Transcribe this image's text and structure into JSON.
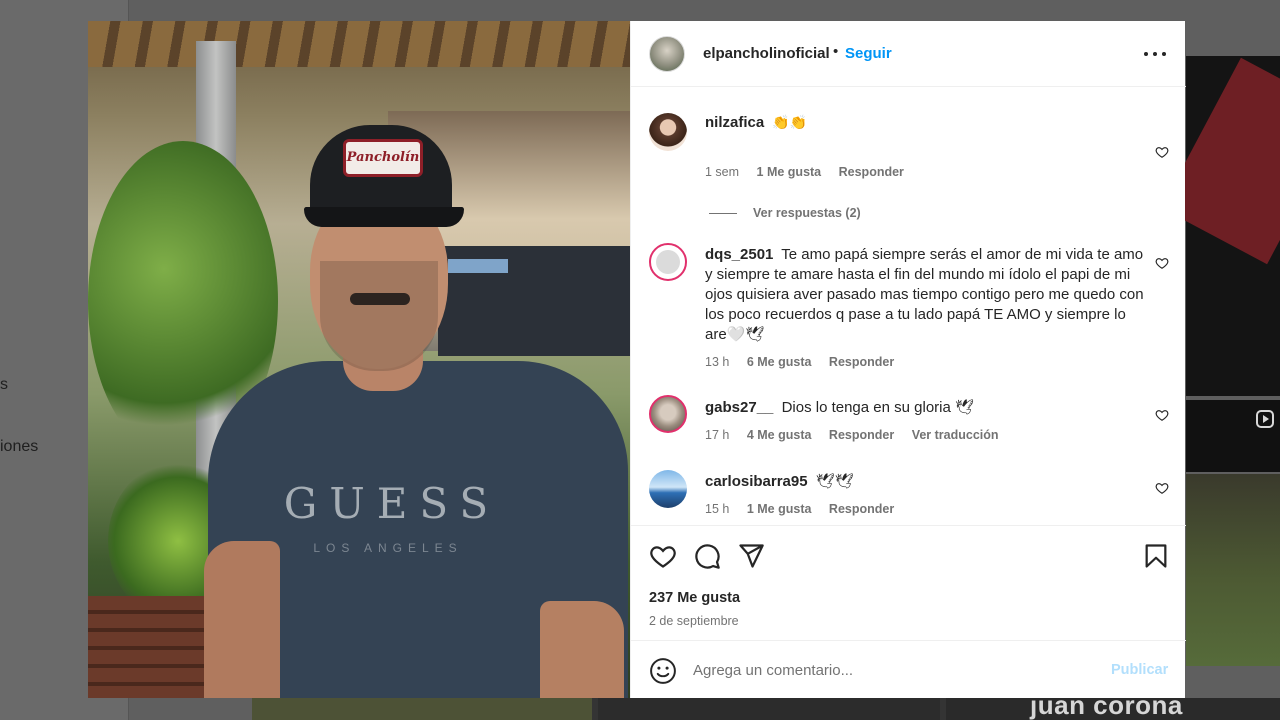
{
  "background": {
    "left_text": "iones",
    "left_text_2": "s",
    "thumb_caption": "juan corona"
  },
  "photo": {
    "cap_patch": "Pancholín",
    "shirt_brand": "GUESS",
    "shirt_sub": "LOS ANGELES"
  },
  "header": {
    "username": "elpancholinoficial",
    "separator": "•",
    "follow_label": "Seguir",
    "more_icon": "more-horizontal-icon"
  },
  "comments": [
    {
      "username": "nilzafica",
      "text": "👏👏",
      "time": "1 sem",
      "likes": "1 Me gusta",
      "reply": "Responder",
      "view_replies": "Ver respuestas (2)"
    },
    {
      "username": "dqs_2501",
      "text": "Te amo papá siempre serás el amor de mi vida te amo y siempre te amare hasta el fin del mundo mi ídolo el papi de mi ojos quisiera aver pasado mas tiempo contigo pero me quedo con los poco recuerdos q pase a tu lado papá TE AMO y siempre lo are🤍🕊",
      "time": "13 h",
      "likes": "6 Me gusta",
      "reply": "Responder"
    },
    {
      "username": "gabs27__",
      "text": "Dios lo tenga en su gloria 🕊",
      "time": "17 h",
      "likes": "4 Me gusta",
      "reply": "Responder",
      "translate": "Ver traducción"
    },
    {
      "username": "carlosibarra95",
      "text": "🕊🕊",
      "time": "15 h",
      "likes": "1 Me gusta",
      "reply": "Responder"
    }
  ],
  "post": {
    "likes": "237 Me gusta",
    "date": "2 de septiembre"
  },
  "add_comment": {
    "placeholder": "Agrega un comentario...",
    "publish_label": "Publicar"
  },
  "colors": {
    "accent": "#0095f6",
    "publish_disabled": "#b2dffc",
    "muted": "#737373",
    "story_ring": "#e1306c"
  }
}
